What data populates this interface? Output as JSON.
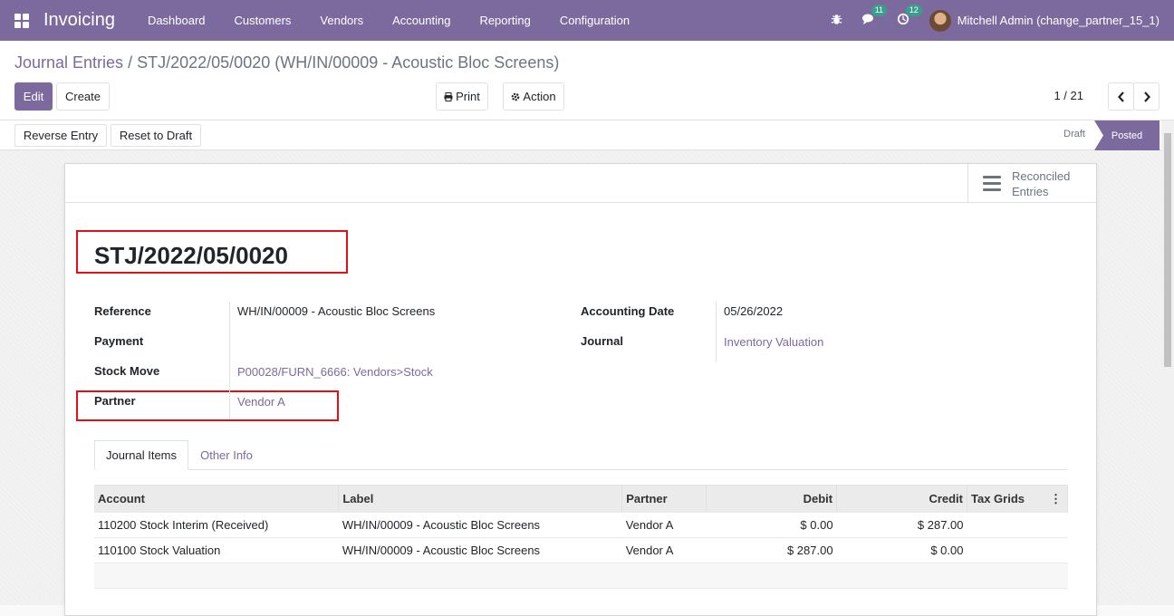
{
  "app": {
    "title": "Invoicing",
    "menu": [
      "Dashboard",
      "Customers",
      "Vendors",
      "Accounting",
      "Reporting",
      "Configuration"
    ]
  },
  "systray": {
    "messages_count": "11",
    "activities_count": "12",
    "user": "Mitchell Admin (change_partner_15_1)"
  },
  "breadcrumb": {
    "parent": "Journal Entries",
    "separator": "/",
    "current": "STJ/2022/05/0020 (WH/IN/00009 - Acoustic Bloc Screens)"
  },
  "buttons": {
    "edit": "Edit",
    "create": "Create",
    "print": "Print",
    "action": "Action",
    "reverse": "Reverse Entry",
    "reset": "Reset to Draft"
  },
  "pager": {
    "value": "1 / 21"
  },
  "status": {
    "stages": [
      "Draft",
      "Posted"
    ],
    "current": "Posted"
  },
  "smart_button": {
    "line1": "Reconciled",
    "line2": "Entries"
  },
  "record": {
    "name": "STJ/2022/05/0020",
    "reference_label": "Reference",
    "reference": "WH/IN/00009 - Acoustic Bloc Screens",
    "payment_label": "Payment",
    "payment": "",
    "stock_move_label": "Stock Move",
    "stock_move": "P00028/FURN_6666: Vendors>Stock",
    "partner_label": "Partner",
    "partner": "Vendor A",
    "accounting_date_label": "Accounting Date",
    "accounting_date": "05/26/2022",
    "journal_label": "Journal",
    "journal": "Inventory Valuation"
  },
  "tabs": [
    "Journal Items",
    "Other Info"
  ],
  "table": {
    "headers": [
      "Account",
      "Label",
      "Partner",
      "Debit",
      "Credit",
      "Tax Grids"
    ],
    "rows": [
      [
        "110200 Stock Interim (Received)",
        "WH/IN/00009 - Acoustic Bloc Screens",
        "Vendor A",
        "$ 0.00",
        "$ 287.00",
        ""
      ],
      [
        "110100 Stock Valuation",
        "WH/IN/00009 - Acoustic Bloc Screens",
        "Vendor A",
        "$ 287.00",
        "$ 0.00",
        ""
      ]
    ]
  },
  "colors": {
    "brand": "#7c6a9e",
    "highlight": "#e0101a"
  }
}
